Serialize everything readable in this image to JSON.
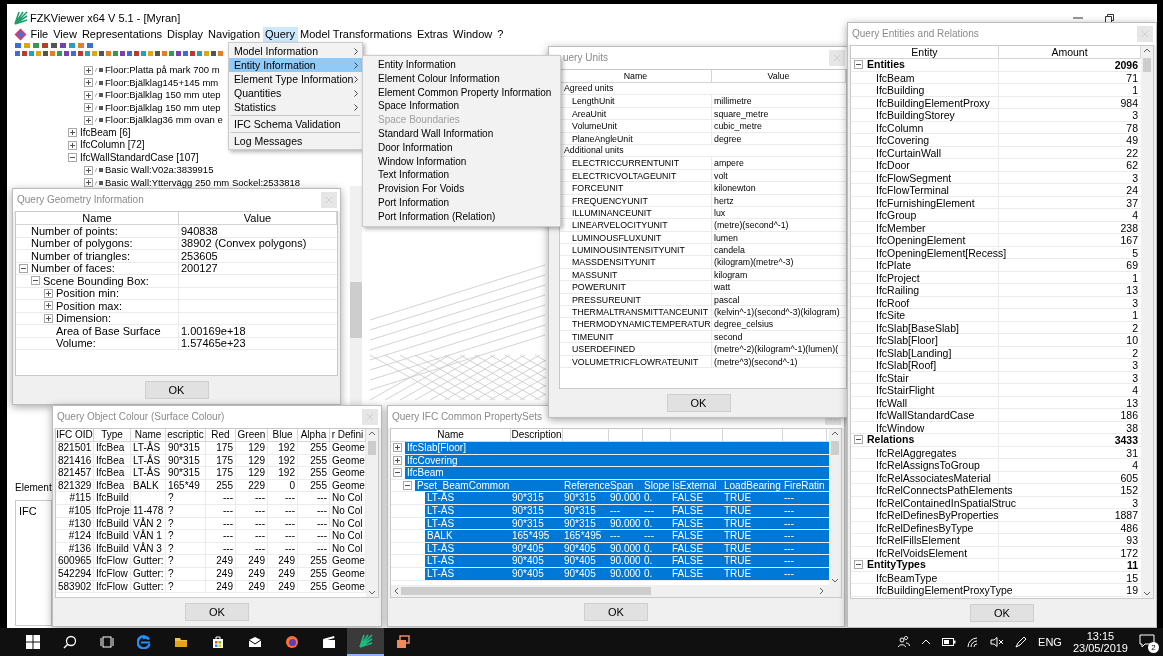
{
  "window": {
    "title": "FZKViewer x64 V 5.1 - [Myran]"
  },
  "menu_bar": [
    {
      "label": "File",
      "selected": false
    },
    {
      "label": "View",
      "selected": false
    },
    {
      "label": "Representations",
      "selected": false
    },
    {
      "label": "Display",
      "selected": false
    },
    {
      "label": "Navigation",
      "selected": false
    },
    {
      "label": "Query",
      "selected": true
    },
    {
      "label": "Model Transformations",
      "selected": false
    },
    {
      "label": "Extras",
      "selected": false
    },
    {
      "label": "Window",
      "selected": false
    },
    {
      "label": "?",
      "selected": false
    }
  ],
  "model_tree": {
    "continued_children": [
      {
        "label": "Floor:Platta på mark 700 m",
        "expanded": false
      },
      {
        "label": "Floor:Bjälklag145+145 mm",
        "expanded": false
      },
      {
        "label": "Floor:Bjälklag 150 mm utep",
        "expanded": false
      },
      {
        "label": "Floor:Bjälklag 150 mm utep",
        "expanded": false
      },
      {
        "label": "Floor:Bjälklag36 mm ovan e",
        "expanded": false
      }
    ],
    "items": [
      {
        "label": "IfcBeam [6]",
        "expanded": false
      },
      {
        "label": "IfcColumn [72]",
        "expanded": false
      },
      {
        "label": "IfcWallStandardCase [107]",
        "expanded": true,
        "children": [
          {
            "label": "Basic Wall:V02a:3839915",
            "expanded": false
          },
          {
            "label": "Basic Wall:Yttervägg 250 mm Sockel:2533818",
            "expanded": false
          }
        ]
      }
    ]
  },
  "query_menu": [
    {
      "label": "Model Information",
      "kind": "submenu",
      "selected": false,
      "separator_before": false
    },
    {
      "label": "Entity Information",
      "kind": "submenu",
      "selected": true,
      "separator_before": false
    },
    {
      "label": "Element Type Information",
      "kind": "submenu",
      "selected": false,
      "separator_before": false
    },
    {
      "label": "Quantities",
      "kind": "submenu",
      "selected": false,
      "separator_before": false
    },
    {
      "label": "Statistics",
      "kind": "submenu",
      "selected": false,
      "separator_before": false
    },
    {
      "label": "IFC Schema Validation",
      "kind": "item",
      "selected": false,
      "separator_before": true
    },
    {
      "label": "Log Messages",
      "kind": "item",
      "selected": false,
      "separator_before": true
    }
  ],
  "entity_submenu": [
    {
      "label": "Entity Information",
      "disabled": false
    },
    {
      "label": "Element Colour Information",
      "disabled": false
    },
    {
      "label": "Element Common Property Information",
      "disabled": false
    },
    {
      "label": "Space Information",
      "disabled": false
    },
    {
      "label": "Space Boundaries",
      "disabled": true
    },
    {
      "label": "Standard Wall Information",
      "disabled": false
    },
    {
      "label": "Door Information",
      "disabled": false
    },
    {
      "label": "Window Information",
      "disabled": false
    },
    {
      "label": "Text Information",
      "disabled": false
    },
    {
      "label": "Provision For Voids",
      "disabled": false
    },
    {
      "label": "Port Information",
      "disabled": false
    },
    {
      "label": "Port Information (Relation)",
      "disabled": false
    }
  ],
  "element_panel": {
    "label": "Element",
    "tree_item": "IFC"
  },
  "geometry_dialog": {
    "title": "Query Geometry Information",
    "columns": [
      "Name",
      "Value"
    ],
    "ok": "OK",
    "rows": [
      {
        "name": "Number of points:",
        "value": "940838"
      },
      {
        "name": "Number of polygons:",
        "value": "38902 (Convex polygons)"
      },
      {
        "name": "Number of triangles:",
        "value": "253605"
      },
      {
        "name": "Number of faces:",
        "value": "200127",
        "expanded": true,
        "children": [
          {
            "name": "Scene Bounding Box:",
            "expanded": true,
            "children": [
              {
                "name": "Position min:",
                "expanded": false
              },
              {
                "name": "Position max:",
                "expanded": false
              },
              {
                "name": "Dimension:",
                "expanded": false
              },
              {
                "name": "Area of Base Surface",
                "value": "1.00169e+18"
              },
              {
                "name": "Volume:",
                "value": "1.57465e+23"
              }
            ]
          }
        ]
      }
    ]
  },
  "units_dialog": {
    "title": "uery Units",
    "columns": [
      "Name",
      "Value"
    ],
    "ok": "OK",
    "groups": [
      {
        "name": "Agreed units",
        "children": [
          {
            "name": "LengthUnit",
            "value": "millimetre"
          },
          {
            "name": "AreaUnit",
            "value": "square_metre"
          },
          {
            "name": "VolumeUnit",
            "value": "cubic_metre"
          },
          {
            "name": "PlaneAngleUnit",
            "value": "degree"
          }
        ]
      },
      {
        "name": "Additional units",
        "children": [
          {
            "name": "ELECTRICCURRENTUNIT",
            "value": "ampere"
          },
          {
            "name": "ELECTRICVOLTAGEUNIT",
            "value": "volt"
          },
          {
            "name": "FORCEUNIT",
            "value": "kilonewton"
          },
          {
            "name": "FREQUENCYUNIT",
            "value": "hertz"
          },
          {
            "name": "ILLUMINANCEUNIT",
            "value": "lux"
          },
          {
            "name": "LINEARVELOCITYUNIT",
            "value": "(metre)(second^-1)"
          },
          {
            "name": "LUMINOUSFLUXUNIT",
            "value": "lumen"
          },
          {
            "name": "LUMINOUSINTENSITYUNIT",
            "value": "candela"
          },
          {
            "name": "MASSDENSITYUNIT",
            "value": "(kilogram)(metre^-3)"
          },
          {
            "name": "MASSUNIT",
            "value": "kilogram"
          },
          {
            "name": "POWERUNIT",
            "value": "watt"
          },
          {
            "name": "PRESSUREUNIT",
            "value": "pascal"
          },
          {
            "name": "THERMALTRANSMITTANCEUNIT",
            "value": "(kelvin^-1)(second^-3)(kilogram)"
          },
          {
            "name": "THERMODYNAMICTEMPERATUR",
            "value": "degree_celsius"
          },
          {
            "name": "TIMEUNIT",
            "value": "second"
          },
          {
            "name": "USERDEFINED",
            "value": "(metre^-2)(kilogram^-1)(lumen)("
          },
          {
            "name": "VOLUMETRICFLOWRATEUNIT",
            "value": "(metre^3)(second^-1)"
          }
        ]
      }
    ]
  },
  "colour_dialog": {
    "title": "Query Object Colour (Surface Colour)",
    "ok": "OK",
    "columns": [
      "IFC OID",
      "Type",
      "Name",
      "escriptic",
      "Red",
      "Green",
      "Blue",
      "Alpha",
      "r Defini"
    ],
    "rows": [
      [
        "821501",
        "IfcBea",
        "LT-ÅS",
        "90*315",
        "175",
        "129",
        "192",
        "255",
        "Geome"
      ],
      [
        "821416",
        "IfcBea",
        "LT-ÅS",
        "90*315",
        "175",
        "129",
        "192",
        "255",
        "Geome"
      ],
      [
        "821457",
        "IfcBea",
        "LT-ÅS",
        "90*315",
        "175",
        "129",
        "192",
        "255",
        "Geome"
      ],
      [
        "821329",
        "IfcBea",
        "BALK",
        "165*49",
        "255",
        "229",
        "0",
        "255",
        "Geome"
      ],
      [
        "#115",
        "IfcBuild",
        null,
        "?",
        "---",
        "---",
        "---",
        "---",
        "No Col"
      ],
      [
        "#105",
        "IfcProje",
        "11-478",
        "?",
        "---",
        "---",
        "---",
        "---",
        "No Col"
      ],
      [
        "#130",
        "IfcBuild",
        "VÅN 2",
        "?",
        "---",
        "---",
        "---",
        "---",
        "No Col"
      ],
      [
        "#124",
        "IfcBuild",
        "VÅN 1",
        "?",
        "---",
        "---",
        "---",
        "---",
        "No Col"
      ],
      [
        "#136",
        "IfcBuild",
        "VÅN 3",
        "?",
        "---",
        "---",
        "---",
        "---",
        "No Col"
      ],
      [
        "600965",
        "IfcFlow",
        "Gutter:",
        "?",
        "249",
        "249",
        "249",
        "255",
        "Geome"
      ],
      [
        "542294",
        "IfcFlow",
        "Gutter:",
        "?",
        "249",
        "249",
        "249",
        "255",
        "Geome"
      ],
      [
        "583902",
        "IfcFlow",
        "Gutter:",
        "?",
        "249",
        "249",
        "249",
        "255",
        "Geome"
      ]
    ]
  },
  "propertysets_dialog": {
    "title": "Query IFC Common PropertySets",
    "ok": "OK",
    "columns": [
      "Name",
      "Description"
    ],
    "rows": [
      {
        "name": "IfcSlab[Floor]",
        "expanded": false,
        "selected": true
      },
      {
        "name": "IfcCovering",
        "expanded": false,
        "selected": true
      },
      {
        "name": "IfcBeam",
        "expanded": true,
        "selected": true,
        "children": [
          {
            "name": "Pset_BeamCommon",
            "expanded": true,
            "selected": true,
            "cells": [
              null,
              "Reference",
              "Span",
              "Slope",
              "IsExternal",
              "LoadBearing",
              "FireRatin"
            ],
            "children": [
              {
                "name": "LT-ÅS",
                "selected": true,
                "cells": [
                  "90*315",
                  "90*315",
                  "90.000",
                  "0.",
                  "FALSE",
                  "TRUE",
                  "---"
                ]
              },
              {
                "name": "LT-ÅS",
                "selected": true,
                "cells": [
                  "90*315",
                  "90*315",
                  "---",
                  "---",
                  "FALSE",
                  "TRUE",
                  "---"
                ]
              },
              {
                "name": "LT-ÅS",
                "selected": true,
                "cells": [
                  "90*315",
                  "90*315",
                  "90.000",
                  "0.",
                  "FALSE",
                  "TRUE",
                  "---"
                ]
              },
              {
                "name": "BALK",
                "selected": true,
                "cells": [
                  "165*495",
                  "165*495",
                  "---",
                  "---",
                  "FALSE",
                  "TRUE",
                  "---"
                ]
              },
              {
                "name": "LT-ÅS",
                "selected": true,
                "cells": [
                  "90*405",
                  "90*405",
                  "90.000",
                  "0.",
                  "FALSE",
                  "TRUE",
                  "---"
                ]
              },
              {
                "name": "LT-ÅS",
                "selected": true,
                "cells": [
                  "90*405",
                  "90*405",
                  "90.000",
                  "0.",
                  "FALSE",
                  "TRUE",
                  "---"
                ]
              },
              {
                "name": "LT-ÅS",
                "selected": true,
                "cells": [
                  "90*405",
                  "90*405",
                  "90.000",
                  "0.",
                  "FALSE",
                  "TRUE",
                  "---"
                ]
              }
            ]
          }
        ]
      }
    ]
  },
  "entities_dialog": {
    "title": "Query Entities and Relations",
    "columns": [
      "Entity",
      "Amount"
    ],
    "ok": "OK",
    "groups": [
      {
        "name": "Entities",
        "amount": "2096",
        "expanded": true,
        "children": [
          {
            "name": "IfcBeam",
            "amount": "71"
          },
          {
            "name": "IfcBuilding",
            "amount": "1"
          },
          {
            "name": "IfcBuildingElementProxy",
            "amount": "984"
          },
          {
            "name": "IfcBuildingStorey",
            "amount": "3"
          },
          {
            "name": "IfcColumn",
            "amount": "78"
          },
          {
            "name": "IfcCovering",
            "amount": "49"
          },
          {
            "name": "IfcCurtainWall",
            "amount": "22"
          },
          {
            "name": "IfcDoor",
            "amount": "62"
          },
          {
            "name": "IfcFlowSegment",
            "amount": "3"
          },
          {
            "name": "IfcFlowTerminal",
            "amount": "24"
          },
          {
            "name": "IfcFurnishingElement",
            "amount": "37"
          },
          {
            "name": "IfcGroup",
            "amount": "4"
          },
          {
            "name": "IfcMember",
            "amount": "238"
          },
          {
            "name": "IfcOpeningElement",
            "amount": "167"
          },
          {
            "name": "IfcOpeningElement[Recess]",
            "amount": "5"
          },
          {
            "name": "IfcPlate",
            "amount": "69"
          },
          {
            "name": "IfcProject",
            "amount": "1"
          },
          {
            "name": "IfcRailing",
            "amount": "13"
          },
          {
            "name": "IfcRoof",
            "amount": "3"
          },
          {
            "name": "IfcSite",
            "amount": "1"
          },
          {
            "name": "IfcSlab[BaseSlab]",
            "amount": "2"
          },
          {
            "name": "IfcSlab[Floor]",
            "amount": "10"
          },
          {
            "name": "IfcSlab[Landing]",
            "amount": "2"
          },
          {
            "name": "IfcSlab[Roof]",
            "amount": "3"
          },
          {
            "name": "IfcStair",
            "amount": "3"
          },
          {
            "name": "IfcStairFlight",
            "amount": "4"
          },
          {
            "name": "IfcWall",
            "amount": "13"
          },
          {
            "name": "IfcWallStandardCase",
            "amount": "186"
          },
          {
            "name": "IfcWindow",
            "amount": "38"
          }
        ]
      },
      {
        "name": "Relations",
        "amount": "3433",
        "expanded": true,
        "children": [
          {
            "name": "IfcRelAggregates",
            "amount": "31"
          },
          {
            "name": "IfcRelAssignsToGroup",
            "amount": "4"
          },
          {
            "name": "IfcRelAssociatesMaterial",
            "amount": "605"
          },
          {
            "name": "IfcRelConnectsPathElements",
            "amount": "152"
          },
          {
            "name": "IfcRelContainedInSpatialStruc",
            "amount": "3"
          },
          {
            "name": "IfcRelDefinesByProperties",
            "amount": "1887"
          },
          {
            "name": "IfcRelDefinesByType",
            "amount": "486"
          },
          {
            "name": "IfcRelFillsElement",
            "amount": "93"
          },
          {
            "name": "IfcRelVoidsElement",
            "amount": "172"
          }
        ]
      },
      {
        "name": "EntityTypes",
        "amount": "11",
        "expanded": true,
        "children": [
          {
            "name": "IfcBeamType",
            "amount": "15"
          },
          {
            "name": "IfcBuildingElementProxyType",
            "amount": "19"
          }
        ]
      }
    ]
  },
  "taskbar": {
    "apps": [
      {
        "kind": "start",
        "active": false
      },
      {
        "kind": "search",
        "active": false
      },
      {
        "kind": "taskview",
        "active": false
      },
      {
        "kind": "edge",
        "active": false
      },
      {
        "kind": "folder",
        "active": false
      },
      {
        "kind": "store",
        "active": false
      },
      {
        "kind": "mail",
        "active": false
      },
      {
        "kind": "firefox",
        "active": false
      },
      {
        "kind": "media",
        "active": false
      },
      {
        "kind": "viewer",
        "active": true
      },
      {
        "kind": "windows",
        "active": false
      }
    ],
    "language": "ENG",
    "time": "13:15",
    "date": "23/05/2019",
    "notifications": "2"
  }
}
